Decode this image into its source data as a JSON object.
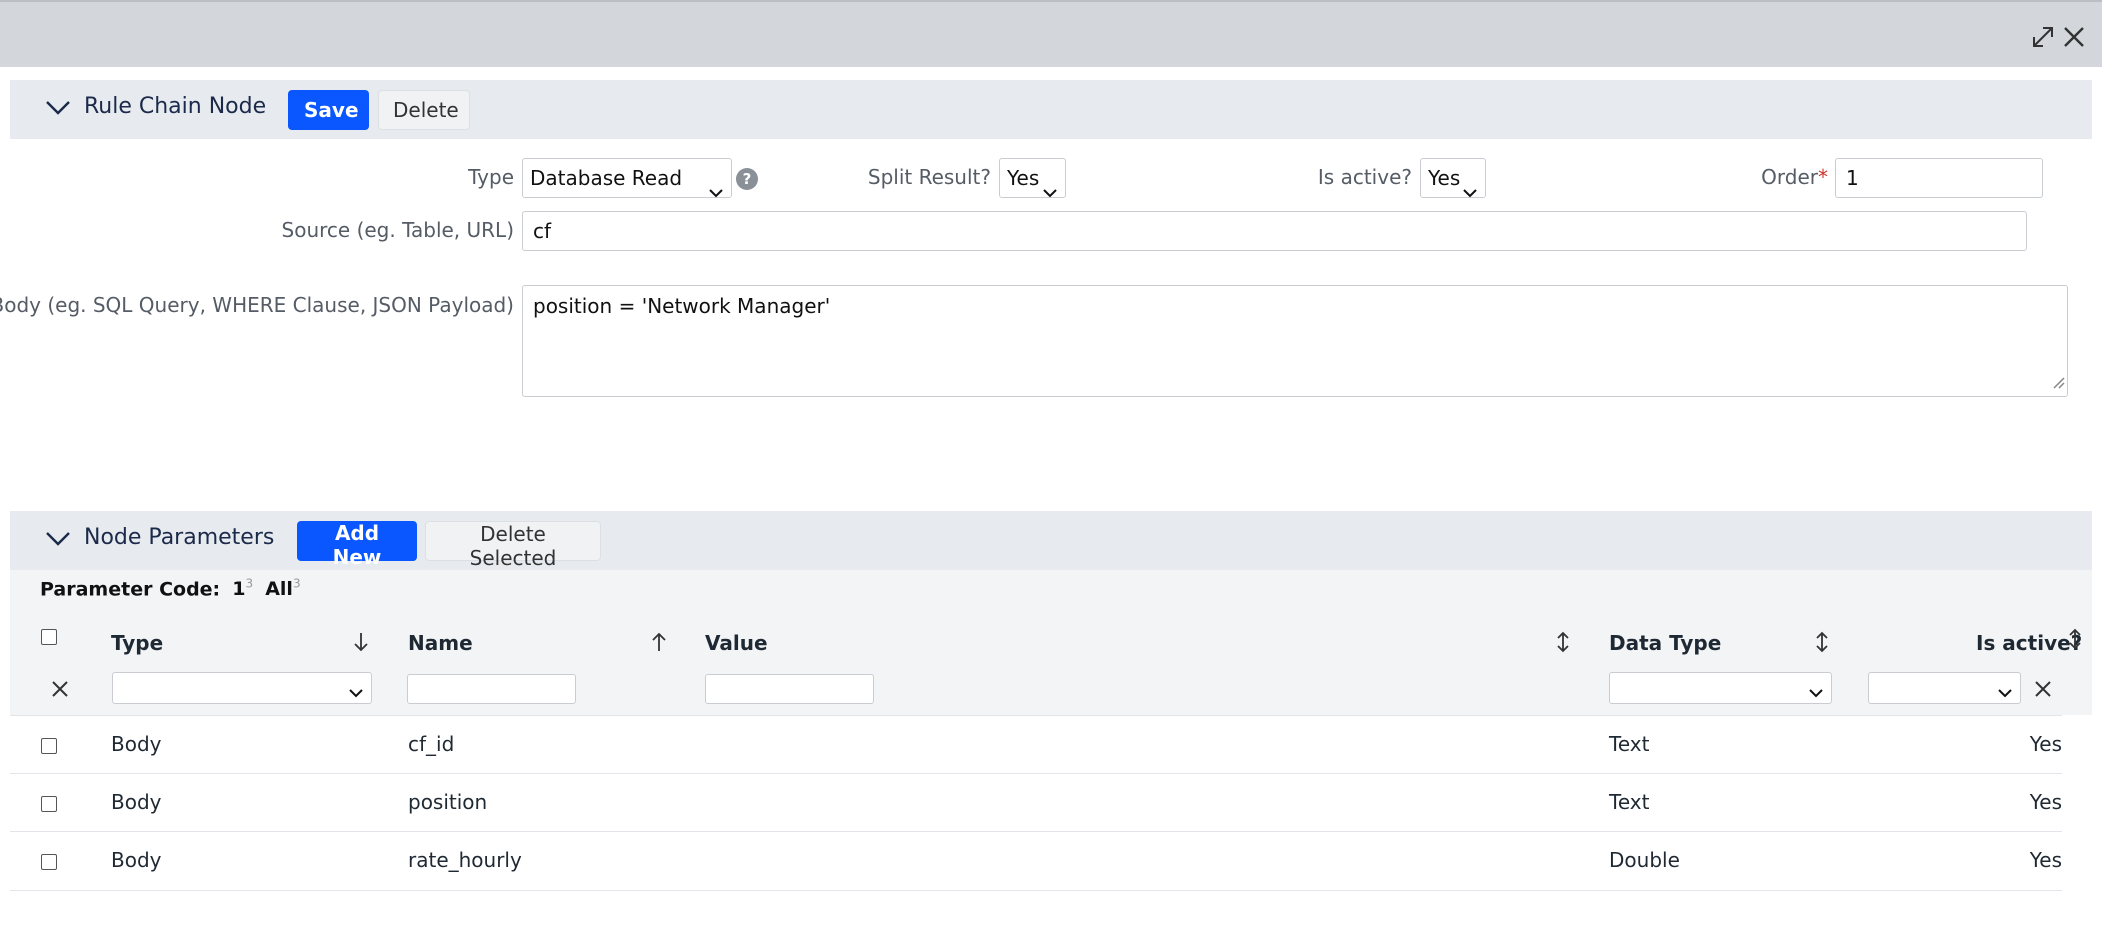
{
  "window": {
    "expand_icon": "expand-arrows-icon",
    "close_icon": "close-x-icon"
  },
  "rule_chain_node": {
    "title": "Rule Chain Node",
    "save_label": "Save",
    "delete_label": "Delete",
    "type_label": "Type",
    "type_value": "Database Read",
    "split_result_label": "Split Result?",
    "split_result_value": "Yes",
    "is_active_label": "Is active?",
    "is_active_value": "Yes",
    "order_label": "Order",
    "order_required": "*",
    "order_value": "1",
    "source_label": "Source (eg. Table, URL)",
    "source_value": "cf",
    "body_label": "Body (eg. SQL Query, WHERE Clause, JSON Payload)",
    "body_value": "position = 'Network Manager'"
  },
  "node_parameters": {
    "title": "Node Parameters",
    "add_new_label": "Add New",
    "delete_selected_label": "Delete Selected",
    "parameter_code_label": "Parameter Code:",
    "code_options": [
      {
        "label": "1",
        "count": "3"
      },
      {
        "label": "All",
        "count": "3"
      }
    ],
    "columns": {
      "type": "Type",
      "name": "Name",
      "value": "Value",
      "data_type": "Data Type",
      "is_active": "Is active?"
    },
    "rows": [
      {
        "type": "Body",
        "name": "cf_id",
        "value": "",
        "data_type": "Text",
        "is_active": "Yes"
      },
      {
        "type": "Body",
        "name": "position",
        "value": "",
        "data_type": "Text",
        "is_active": "Yes"
      },
      {
        "type": "Body",
        "name": "rate_hourly",
        "value": "",
        "data_type": "Double",
        "is_active": "Yes"
      }
    ]
  },
  "colors": {
    "primary": "#0a57ff",
    "header_bg": "#e7eaee",
    "topbar_bg": "#d3d7db"
  }
}
